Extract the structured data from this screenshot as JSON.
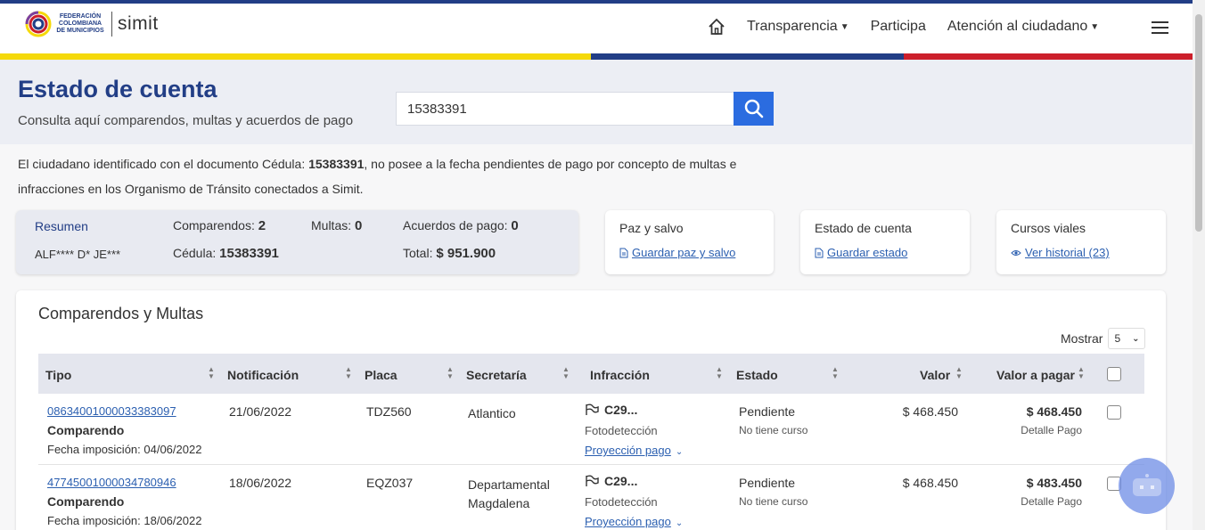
{
  "header": {
    "logo_text": "FEDERACIÓN COLOMBIANA DE MUNICIPIOS",
    "logo_brand": "simit",
    "nav": {
      "home_icon": "home-icon",
      "transparencia": "Transparencia",
      "participa": "Participa",
      "atencion": "Atención al ciudadano"
    }
  },
  "colors": {
    "primary": "#223e86",
    "accent": "#2b6ce0",
    "yellow": "#f5d90a",
    "blue": "#223e86",
    "red": "#cc1f2b"
  },
  "hero": {
    "title": "Estado de cuenta",
    "subtitle": "Consulta aquí comparendos, multas y acuerdos de pago",
    "search_value": "15383391"
  },
  "notice": {
    "prefix": "El ciudadano identificado con el documento Cédula: ",
    "doc": "15383391",
    "suffix": ", no posee a la fecha pendientes de pago por concepto de multas e infracciones en los Organismo de Tránsito conectados a Simit."
  },
  "resumen": {
    "title": "Resumen",
    "name": "ALF**** D* JE***",
    "comparendos_label": "Comparendos:",
    "comparendos": "2",
    "multas_label": "Multas:",
    "multas": "0",
    "acuerdos_label": "Acuerdos de pago:",
    "acuerdos": "0",
    "cedula_label": "Cédula:",
    "cedula": "15383391",
    "total_label": "Total:",
    "total": "$ 951.900"
  },
  "cards": [
    {
      "title": "Paz y salvo",
      "link": "Guardar paz y salvo"
    },
    {
      "title": "Estado de cuenta",
      "link": "Guardar estado"
    },
    {
      "title": "Cursos viales",
      "link": "Ver historial (23)"
    }
  ],
  "table": {
    "title": "Comparendos y Multas",
    "mostrar_label": "Mostrar",
    "mostrar_value": "5",
    "headers": [
      "Tipo",
      "Notificación",
      "Placa",
      "Secretaría",
      "Infracción",
      "Estado",
      "Valor",
      "Valor a pagar"
    ],
    "rows": [
      {
        "numero": "08634001000033383097",
        "tipo": "Comparendo",
        "fecha": "Fecha imposición: 04/06/2022",
        "notificacion": "21/06/2022",
        "placa": "TDZ560",
        "secretaria": "Atlantico",
        "secretaria2": "",
        "infraccion": "C29...",
        "medio": "Fotodetección",
        "proyeccion": "Proyección pago",
        "estado": "Pendiente",
        "curso": "No tiene curso",
        "valor": "$ 468.450",
        "valor_pagar": "$ 468.450",
        "detalle": "Detalle Pago"
      },
      {
        "numero": "47745001000034780946",
        "tipo": "Comparendo",
        "fecha": "Fecha imposición: 18/06/2022",
        "notificacion": "18/06/2022",
        "placa": "EQZ037",
        "secretaria": "Departamental",
        "secretaria2": "Magdalena",
        "infraccion": "C29...",
        "medio": "Fotodetección",
        "proyeccion": "Proyección pago",
        "estado": "Pendiente",
        "curso": "No tiene curso",
        "valor": "$ 468.450",
        "valor_pagar": "$ 483.450",
        "detalle": "Detalle Pago"
      }
    ]
  }
}
